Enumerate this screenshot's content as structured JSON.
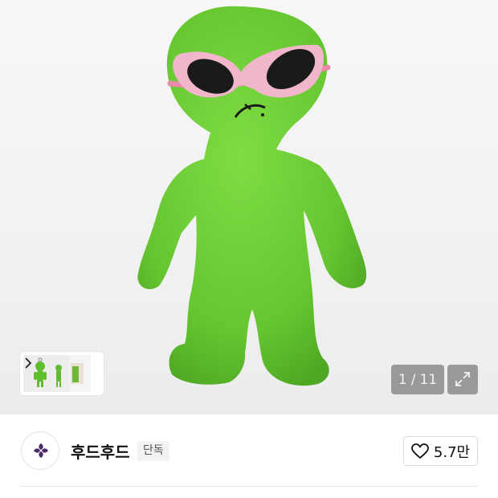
{
  "gallery": {
    "product_image": "green-alien-plush-keyring",
    "current_index": "1",
    "separator": "/",
    "total": "11",
    "expand_icon": "expand-arrows-icon",
    "thumbnails_next_icon": "chevron-right-icon"
  },
  "brand": {
    "logo": "brand-logo",
    "name": "후드후드",
    "badge": "단독"
  },
  "like": {
    "icon": "heart-icon",
    "count": "5.7만"
  },
  "colors": {
    "plush_green": "#6ccf35",
    "glasses_pink": "#f2b6cc",
    "logo_purple": "#4b2a6b"
  }
}
